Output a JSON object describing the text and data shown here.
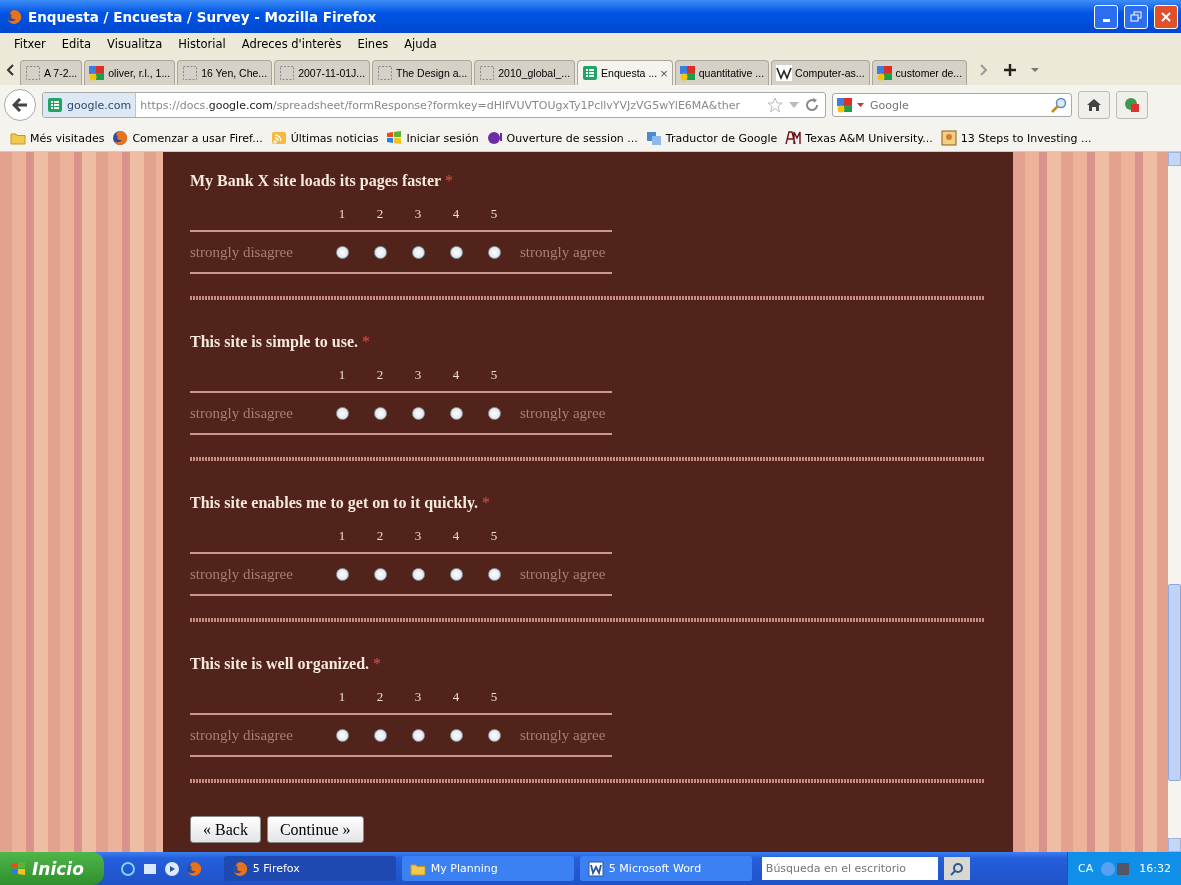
{
  "window": {
    "title": "Enquesta / Encuesta / Survey - Mozilla Firefox"
  },
  "menu": [
    "Fitxer",
    "Edita",
    "Visualitza",
    "Historial",
    "Adreces d'interès",
    "Eines",
    "Ajuda"
  ],
  "tabs": [
    {
      "label": "A 7-2...",
      "kind": "blank",
      "selected": false
    },
    {
      "label": "oliver, r.l., 1...",
      "kind": "google",
      "selected": false
    },
    {
      "label": "16 Yen, Che...",
      "kind": "blank",
      "selected": false
    },
    {
      "label": "2007-11-01J...",
      "kind": "blank",
      "selected": false
    },
    {
      "label": "The Design a...",
      "kind": "blank",
      "selected": false
    },
    {
      "label": "2010_global_...",
      "kind": "blank",
      "selected": false
    },
    {
      "label": "Enquesta ...",
      "kind": "sheet",
      "selected": true,
      "close": "×"
    },
    {
      "label": "quantitative ...",
      "kind": "google",
      "selected": false
    },
    {
      "label": "Computer-as...",
      "kind": "wiki",
      "selected": false
    },
    {
      "label": "customer de...",
      "kind": "google",
      "selected": false
    }
  ],
  "address": {
    "site": "google.com",
    "url": "https://docs.**google.com**/spreadsheet/formResponse?formkey=dHlfVUVTOUgxTy1PcllvYVJzVG5wYlE6MA&ther"
  },
  "search": {
    "placeholder": "Google"
  },
  "bookmarks": [
    {
      "label": "Més visitades",
      "kind": "folder"
    },
    {
      "label": "Comenzar a usar Firef...",
      "kind": "firefox"
    },
    {
      "label": "Últimas noticias",
      "kind": "rss"
    },
    {
      "label": "Iniciar sesión",
      "kind": "windows"
    },
    {
      "label": "Ouverture de session ...",
      "kind": "yahoo"
    },
    {
      "label": "Traductor de Google",
      "kind": "translate"
    },
    {
      "label": "Texas A&M University...",
      "kind": "tamu"
    },
    {
      "label": "13 Steps to Investing ...",
      "kind": "picture"
    }
  ],
  "questions": [
    {
      "title": "My Bank X site loads its pages faster",
      "required": "*",
      "low": "strongly disagree",
      "high": "strongly agree",
      "options": [
        {
          "label": "1",
          "selected": false
        },
        {
          "label": "2",
          "selected": false
        },
        {
          "label": "3",
          "selected": false
        },
        {
          "label": "4",
          "selected": false
        },
        {
          "label": "5",
          "selected": false
        }
      ]
    },
    {
      "title": "This site is simple to use.",
      "required": "*",
      "low": "strongly disagree",
      "high": "strongly agree",
      "options": [
        {
          "label": "1",
          "selected": false
        },
        {
          "label": "2",
          "selected": false
        },
        {
          "label": "3",
          "selected": false
        },
        {
          "label": "4",
          "selected": false
        },
        {
          "label": "5",
          "selected": false
        }
      ]
    },
    {
      "title": "This site enables me to get on to it quickly.",
      "required": "*",
      "low": "strongly disagree",
      "high": "strongly agree",
      "options": [
        {
          "label": "1",
          "selected": false
        },
        {
          "label": "2",
          "selected": false
        },
        {
          "label": "3",
          "selected": false
        },
        {
          "label": "4",
          "selected": false
        },
        {
          "label": "5",
          "selected": false
        }
      ]
    },
    {
      "title": "This site is well organized.",
      "required": "*",
      "low": "strongly disagree",
      "high": "strongly agree",
      "options": [
        {
          "label": "1",
          "selected": false
        },
        {
          "label": "2",
          "selected": false
        },
        {
          "label": "3",
          "selected": false
        },
        {
          "label": "4",
          "selected": false
        },
        {
          "label": "5",
          "selected": false
        }
      ]
    }
  ],
  "buttons": [
    "« Back",
    "Continue »"
  ],
  "taskbar": {
    "start": "Inicio",
    "items": [
      {
        "label": "5 Firefox",
        "kind": "firefox",
        "selected": true
      },
      {
        "label": "My Planning",
        "kind": "folder",
        "selected": false
      },
      {
        "label": "5 Microsoft Word",
        "kind": "word",
        "selected": false
      }
    ],
    "search_placeholder": "Búsqueda en el escritorio",
    "language": "CA",
    "time": "16:32"
  }
}
